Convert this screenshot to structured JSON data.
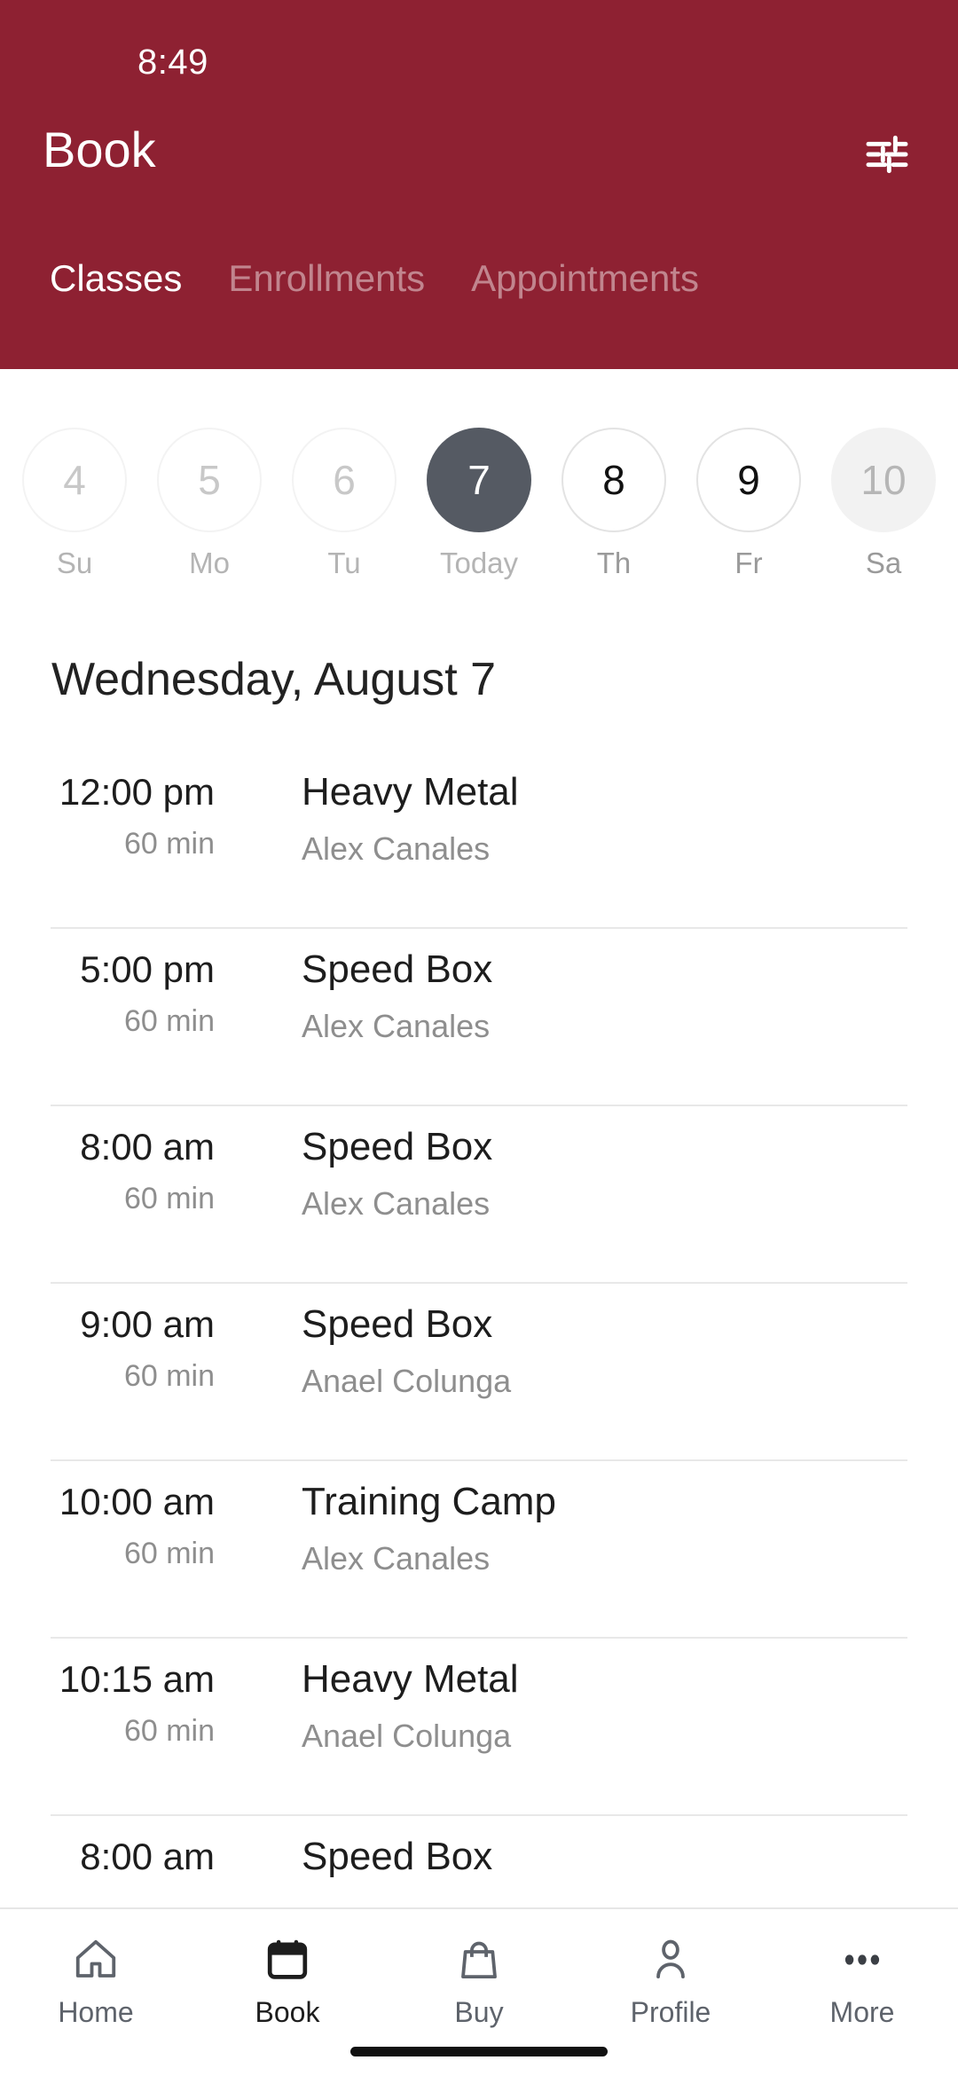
{
  "status_bar": {
    "time": "8:49"
  },
  "header": {
    "title": "Book",
    "filter_icon": "tune-icon",
    "background_color": "#8E2132",
    "tabs": [
      {
        "label": "Classes",
        "active": true
      },
      {
        "label": "Enrollments",
        "active": false
      },
      {
        "label": "Appointments",
        "active": false
      }
    ]
  },
  "date_strip": {
    "days": [
      {
        "num": "4",
        "label": "Su",
        "state": "past"
      },
      {
        "num": "5",
        "label": "Mo",
        "state": "past"
      },
      {
        "num": "6",
        "label": "Tu",
        "state": "past"
      },
      {
        "num": "7",
        "label": "Today",
        "state": "selected"
      },
      {
        "num": "8",
        "label": "Th",
        "state": "future"
      },
      {
        "num": "9",
        "label": "Fr",
        "state": "future"
      },
      {
        "num": "10",
        "label": "Sa",
        "state": "disabled"
      }
    ],
    "selected_color": "#555A63"
  },
  "day_heading": "Wednesday, August 7",
  "classes": [
    {
      "time": "12:00 pm",
      "duration": "60 min",
      "name": "Heavy Metal",
      "instructor": "Alex Canales"
    },
    {
      "time": "5:00 pm",
      "duration": "60 min",
      "name": "Speed Box",
      "instructor": "Alex Canales"
    },
    {
      "time": "8:00 am",
      "duration": "60 min",
      "name": "Speed Box",
      "instructor": "Alex Canales"
    },
    {
      "time": "9:00 am",
      "duration": "60 min",
      "name": "Speed Box",
      "instructor": "Anael Colunga"
    },
    {
      "time": "10:00 am",
      "duration": "60 min",
      "name": "Training Camp",
      "instructor": "Alex Canales"
    },
    {
      "time": "10:15 am",
      "duration": "60 min",
      "name": "Heavy Metal",
      "instructor": "Anael Colunga"
    },
    {
      "time": "8:00 am",
      "duration": "",
      "name": "Speed Box",
      "instructor": ""
    }
  ],
  "bottom_nav": {
    "items": [
      {
        "label": "Home",
        "icon": "home-icon",
        "active": false
      },
      {
        "label": "Book",
        "icon": "calendar-icon",
        "active": true
      },
      {
        "label": "Buy",
        "icon": "bag-icon",
        "active": false
      },
      {
        "label": "Profile",
        "icon": "person-icon",
        "active": false
      },
      {
        "label": "More",
        "icon": "ellipsis-icon",
        "active": false
      }
    ]
  }
}
